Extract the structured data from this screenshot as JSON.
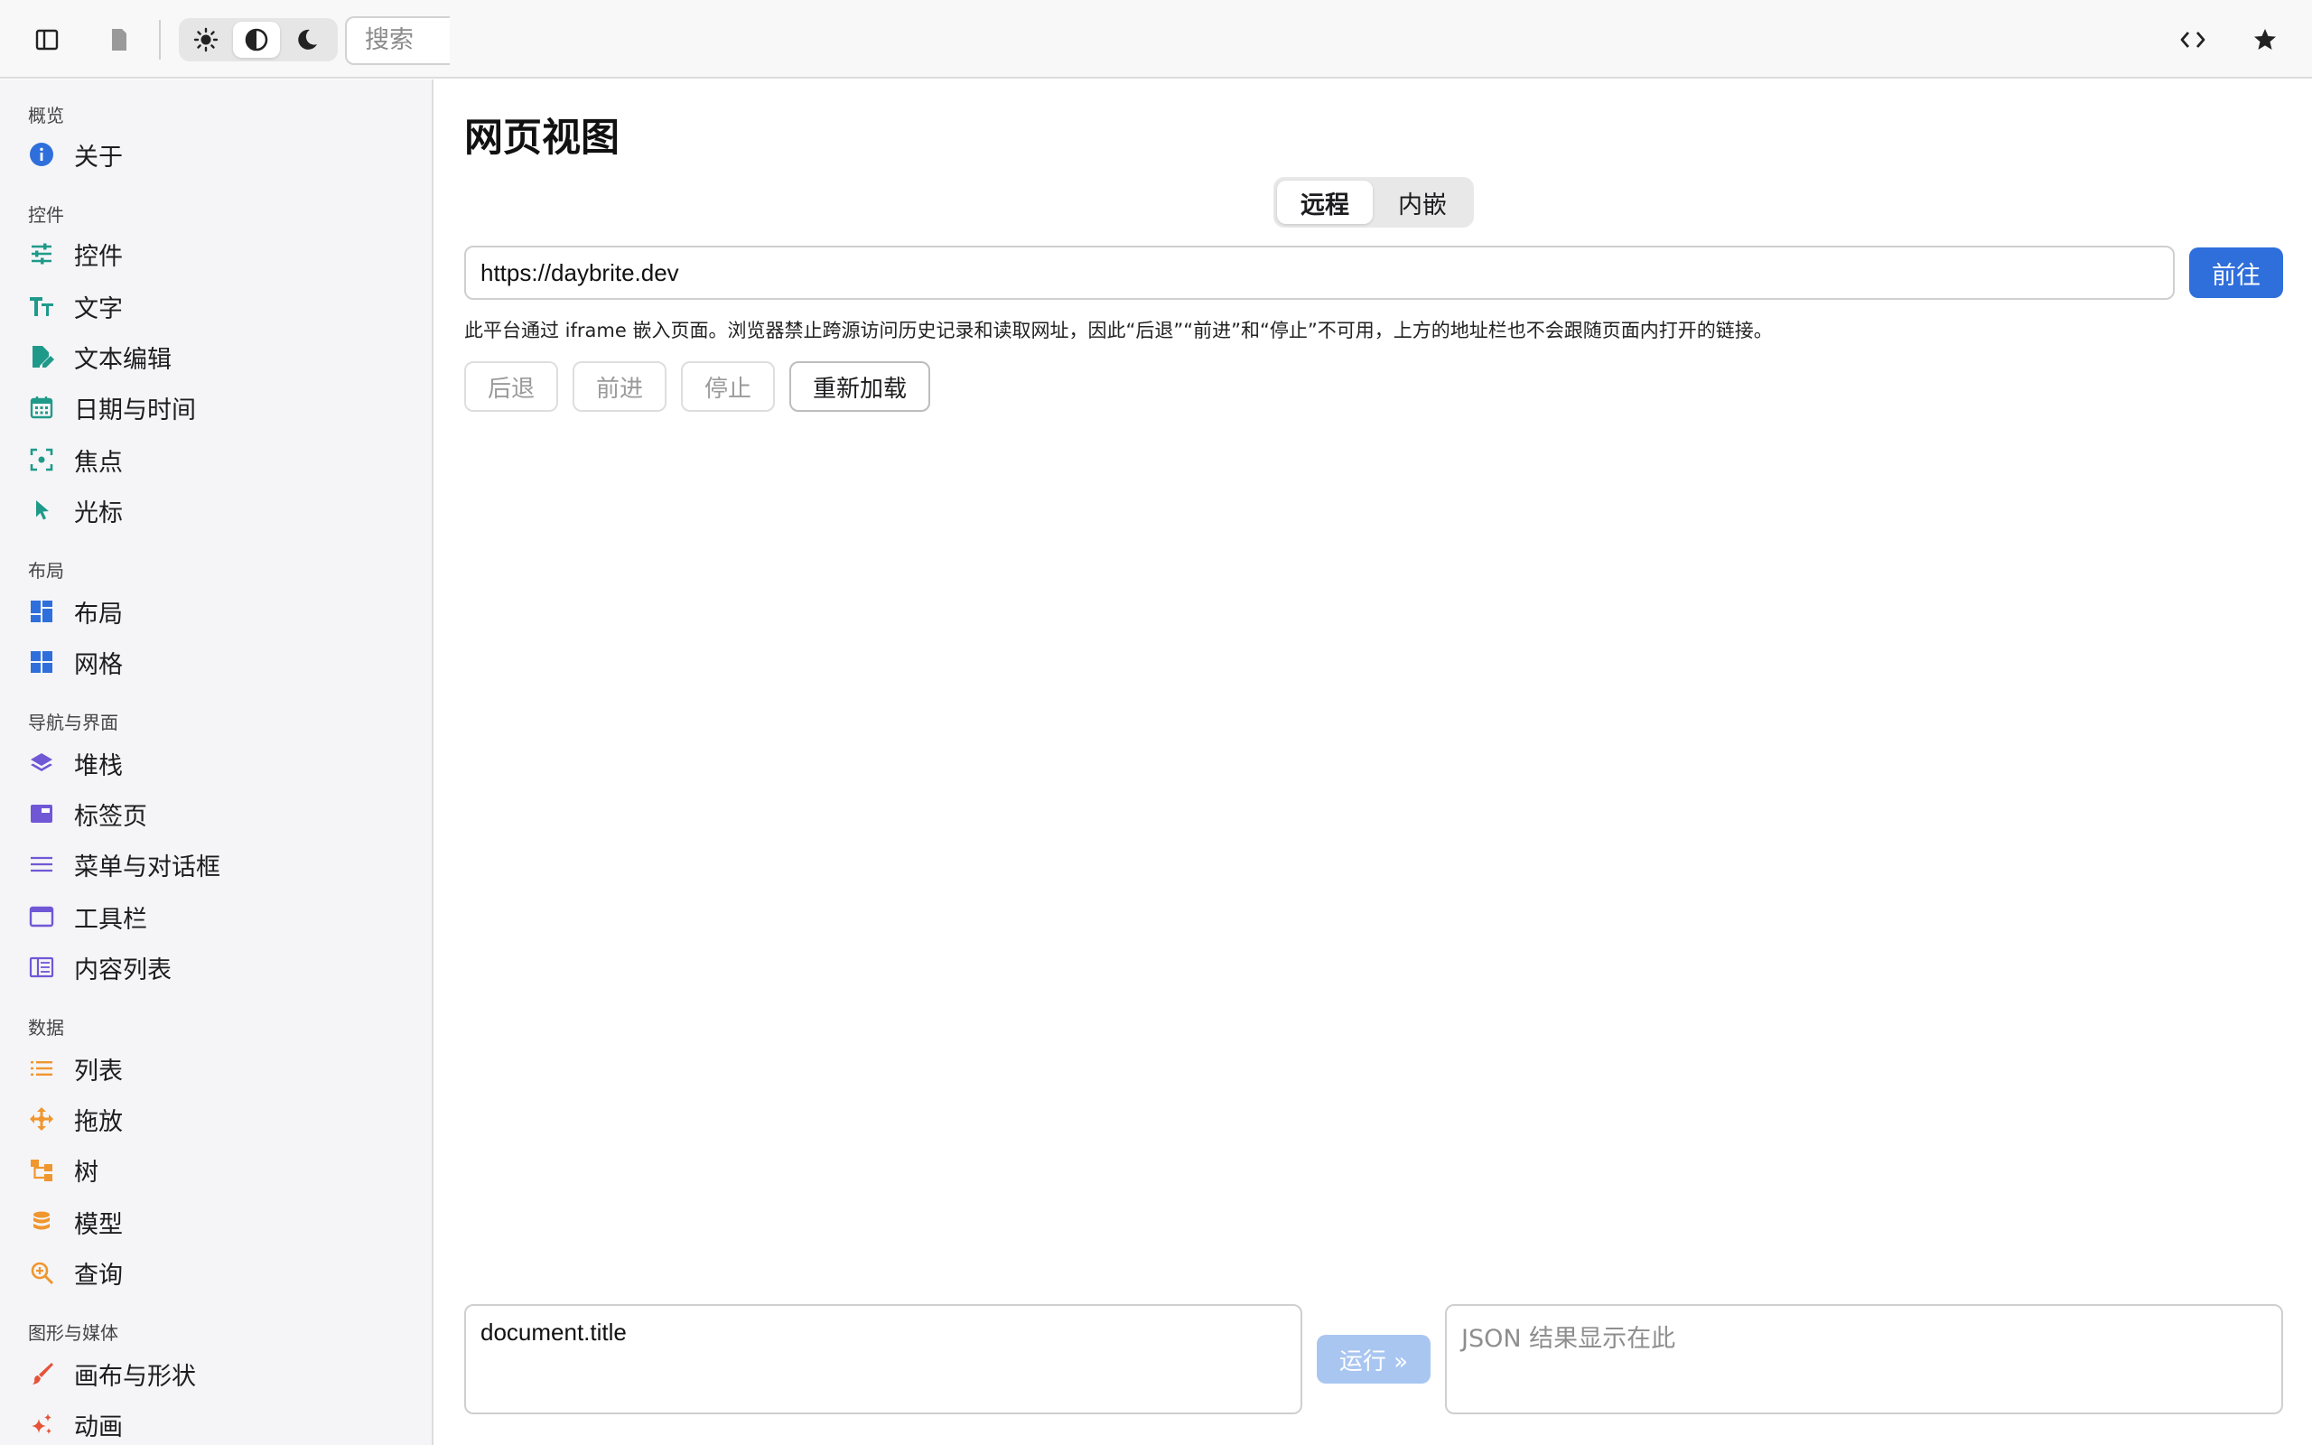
{
  "toolbar": {
    "search_placeholder": "搜索"
  },
  "sidebar": {
    "sections": [
      {
        "title": "概览",
        "items": [
          {
            "label": "关于",
            "icon": "info-icon"
          }
        ]
      },
      {
        "title": "控件",
        "items": [
          {
            "label": "控件",
            "icon": "sliders-icon"
          },
          {
            "label": "文字",
            "icon": "text-size-icon"
          },
          {
            "label": "文本编辑",
            "icon": "edit-document-icon"
          },
          {
            "label": "日期与时间",
            "icon": "calendar-icon"
          },
          {
            "label": "焦点",
            "icon": "focus-icon"
          },
          {
            "label": "光标",
            "icon": "cursor-icon"
          }
        ]
      },
      {
        "title": "布局",
        "items": [
          {
            "label": "布局",
            "icon": "layout-icon"
          },
          {
            "label": "网格",
            "icon": "grid-icon"
          }
        ]
      },
      {
        "title": "导航与界面",
        "items": [
          {
            "label": "堆栈",
            "icon": "layers-icon"
          },
          {
            "label": "标签页",
            "icon": "tab-icon"
          },
          {
            "label": "菜单与对话框",
            "icon": "menu-icon"
          },
          {
            "label": "工具栏",
            "icon": "window-icon"
          },
          {
            "label": "内容列表",
            "icon": "columns-icon"
          }
        ]
      },
      {
        "title": "数据",
        "items": [
          {
            "label": "列表",
            "icon": "list-icon"
          },
          {
            "label": "拖放",
            "icon": "move-icon"
          },
          {
            "label": "树",
            "icon": "tree-icon"
          },
          {
            "label": "模型",
            "icon": "database-icon"
          },
          {
            "label": "查询",
            "icon": "search-zoom-icon"
          }
        ]
      },
      {
        "title": "图形与媒体",
        "items": [
          {
            "label": "画布与形状",
            "icon": "brush-icon"
          },
          {
            "label": "动画",
            "icon": "sparkle-icon"
          }
        ]
      }
    ]
  },
  "main": {
    "title": "网页视图",
    "tabs": [
      {
        "label": "远程",
        "active": true
      },
      {
        "label": "内嵌",
        "active": false
      }
    ],
    "url": "https://daybrite.dev",
    "go_label": "前往",
    "note": "此平台通过 iframe 嵌入页面。浏览器禁止跨源访问历史记录和读取网址，因此“后退”“前进”和“停止”不可用，上方的地址栏也不会跟随页面内打开的链接。",
    "nav_buttons": {
      "back": "后退",
      "forward": "前进",
      "stop": "停止",
      "reload": "重新加载"
    },
    "script_value": "document.title",
    "run_label": "运行 »",
    "result_placeholder": "JSON 结果显示在此"
  },
  "colors": {
    "accent": "#2f6fdb",
    "blue_icons": "#2f6fdb",
    "teal_icons": "#1f9a8a",
    "purple_icons": "#7057d6",
    "orange_icons": "#f0962e",
    "red_icons": "#e5533a"
  }
}
